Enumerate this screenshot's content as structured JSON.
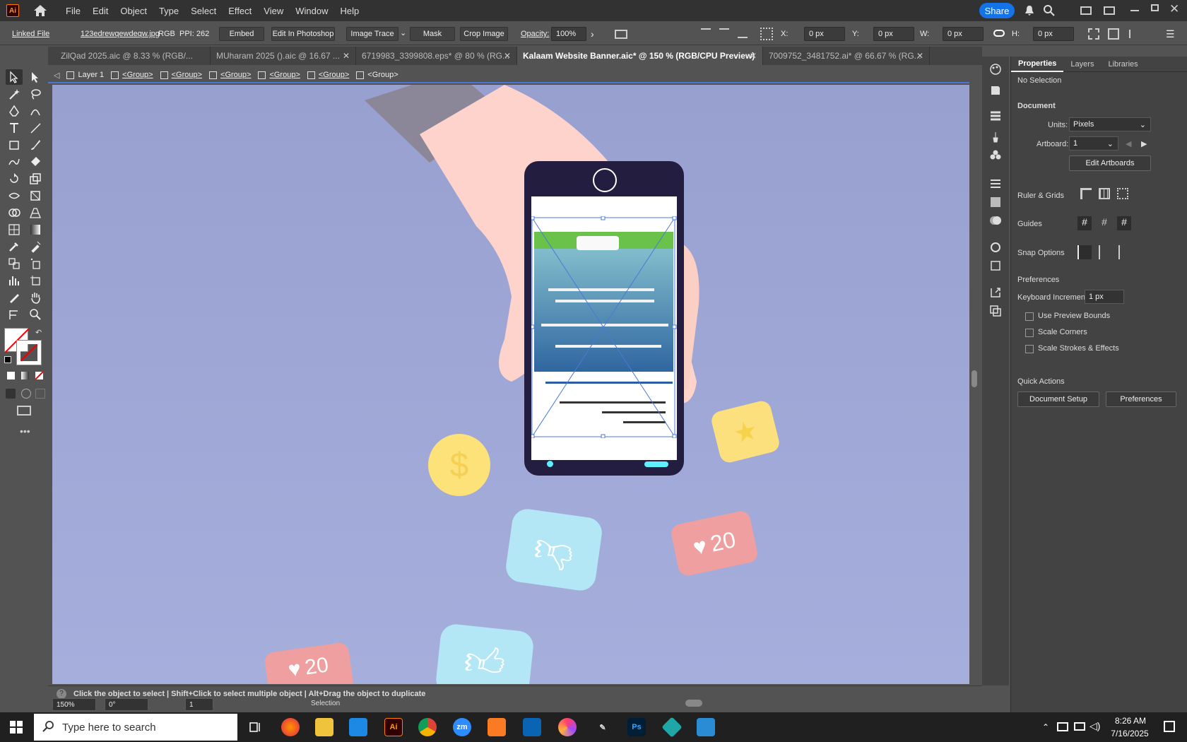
{
  "app": {
    "logo": "Ai",
    "menu": [
      "File",
      "Edit",
      "Object",
      "Type",
      "Select",
      "Effect",
      "View",
      "Window",
      "Help"
    ],
    "share": "Share"
  },
  "control": {
    "linked_file": "Linked File",
    "file_name": "123edrewqewdeqw.jpg",
    "color_mode": "RGB",
    "ppi": "PPI: 262",
    "embed": "Embed",
    "edit_ps": "Edit In Photoshop",
    "image_trace": "Image Trace",
    "mask": "Mask",
    "crop": "Crop Image",
    "opacity_label": "Opacity:",
    "opacity": "100%",
    "x_label": "X:",
    "x_val": "0 px",
    "y_label": "Y:",
    "y_val": "0 px",
    "w_label": "W:",
    "w_val": "0 px",
    "h_label": "H:",
    "h_val": "0 px"
  },
  "tabs": [
    "ZilQad 2025.aic @ 8.33 % (RGB/...",
    "MUharam 2025 ().aic @ 16.67 ...",
    "6719983_3399808.eps* @ 80 % (RG...",
    "Kalaam Website Banner.aic* @ 150 % (RGB/CPU Preview)",
    "7009752_3481752.ai* @ 66.67 % (RG..."
  ],
  "breadcrumb": {
    "layer": "Layer 1",
    "groups": [
      "<Group>",
      "<Group>",
      "<Group>",
      "<Group>",
      "<Group>",
      "<Group>"
    ]
  },
  "panel": {
    "tabs": [
      "Properties",
      "Layers",
      "Libraries"
    ],
    "no_selection": "No Selection",
    "document": "Document",
    "units_label": "Units:",
    "units": "Pixels",
    "artboard_label": "Artboard:",
    "artboard": "1",
    "edit_artboards": "Edit Artboards",
    "rulers": "Ruler & Grids",
    "guides": "Guides",
    "snap": "Snap Options",
    "preferences": "Preferences",
    "kb_label": "Keyboard Increment:",
    "kb_val": "1 px",
    "cb1": "Use Preview Bounds",
    "cb2": "Scale Corners",
    "cb3": "Scale Strokes & Effects",
    "quick_actions": "Quick Actions",
    "doc_setup": "Document Setup",
    "prefs_btn": "Preferences"
  },
  "status": {
    "hint": "Click the object to select  |  Shift+Click to select multiple object  |  Alt+Drag the object to duplicate",
    "zoom": "150%",
    "rotate": "0°",
    "artboard": "1",
    "tool": "Selection"
  },
  "taskbar": {
    "search": "Type here to search",
    "time": "8:26 AM",
    "date": "7/16/2025",
    "ai": "Ai",
    "ps": "Ps",
    "zm": "zm"
  },
  "canvas": {
    "counter": "20",
    "dollar": "$"
  },
  "colors": {
    "canvas_bg": "#9ea6d4",
    "accent": "#1473e6",
    "phone": "#231e3f"
  }
}
